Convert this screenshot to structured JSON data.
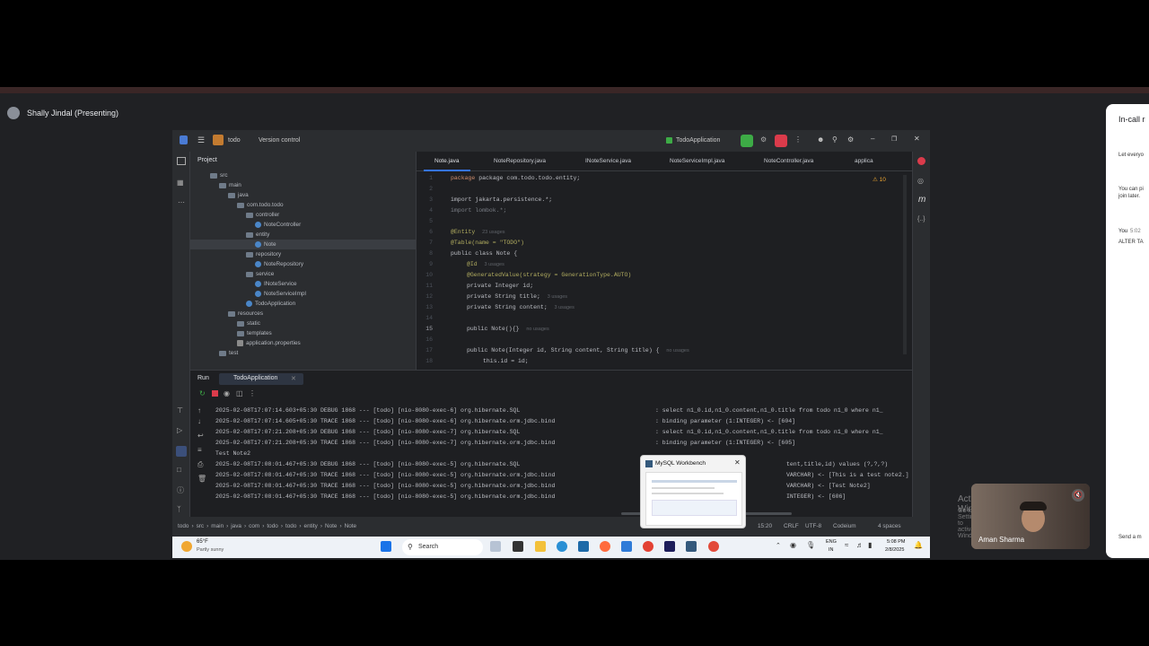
{
  "meet": {
    "presenter_label": "Shally Jindal (Presenting)",
    "side_panel": {
      "title": "In-call r",
      "line1": "Let everyo",
      "line2a": "You can pi",
      "line2b": "join later.",
      "msg_author": "You",
      "msg_time": "5:02",
      "msg_text": "ALTER TA",
      "send_placeholder": "Send a m"
    },
    "webcam_name": "Aman Sharma"
  },
  "ide": {
    "project_name": "todo",
    "vcs": "Version control",
    "run_config": "TodoApplication",
    "project_panel_title": "Project",
    "tree": [
      {
        "label": "src",
        "type": "folder",
        "indent": 0
      },
      {
        "label": "main",
        "type": "folder",
        "indent": 1
      },
      {
        "label": "java",
        "type": "folder",
        "indent": 2
      },
      {
        "label": "com.todo.todo",
        "type": "folder",
        "indent": 3
      },
      {
        "label": "controller",
        "type": "folder",
        "indent": 4
      },
      {
        "label": "NoteController",
        "type": "class",
        "indent": 5
      },
      {
        "label": "entity",
        "type": "folder",
        "indent": 4
      },
      {
        "label": "Note",
        "type": "class",
        "indent": 5,
        "selected": true
      },
      {
        "label": "repository",
        "type": "folder",
        "indent": 4
      },
      {
        "label": "NoteRepository",
        "type": "class",
        "indent": 5
      },
      {
        "label": "service",
        "type": "folder",
        "indent": 4
      },
      {
        "label": "INoteService",
        "type": "class",
        "indent": 5
      },
      {
        "label": "NoteServiceImpl",
        "type": "class",
        "indent": 5
      },
      {
        "label": "TodoApplication",
        "type": "class",
        "indent": 4
      },
      {
        "label": "resources",
        "type": "folder",
        "indent": 2
      },
      {
        "label": "static",
        "type": "folder",
        "indent": 3
      },
      {
        "label": "templates",
        "type": "folder",
        "indent": 3
      },
      {
        "label": "application.properties",
        "type": "prop",
        "indent": 3
      },
      {
        "label": "test",
        "type": "folder",
        "indent": 1
      }
    ],
    "tabs": [
      "Note.java",
      "NoteRepository.java",
      "INoteService.java",
      "NoteServiceImpl.java",
      "NoteController.java",
      "applica"
    ],
    "warnings": "⚠ 10",
    "code_lines": [
      "1",
      "2",
      "3",
      "4",
      "5",
      "6",
      "7",
      "8",
      "9",
      "10",
      "11",
      "12",
      "13",
      "14",
      "15",
      "16",
      "17",
      "18"
    ],
    "code": {
      "l1": "package com.todo.todo.entity;",
      "l3": "import jakarta.persistence.*;",
      "l4": "import lombok.*;",
      "l6": "@Entity",
      "l6h": "23 usages",
      "l7": "@Table(name = \"TODO\")",
      "l8": "public class Note {",
      "l9": "@Id",
      "l9h": "3 usages",
      "l10": "@GeneratedValue(strategy = GenerationType.AUTO)",
      "l11": "private Integer id;",
      "l12": "private String title;",
      "l12h": "3 usages",
      "l13": "private String content;",
      "l13h": "3 usages",
      "l15": "public Note(){}",
      "l15h": "no usages",
      "l17": "public Note(Integer id, String content, String title) {",
      "l17h": "no usages",
      "l18": "this.id = id;"
    },
    "run": {
      "tab_run": "Run",
      "tab_app": "TodoApplication",
      "logs": [
        {
          "left": "2025-02-08T17:07:14.603+05:30 DEBUG 1868 --- [todo] [nio-8080-exec-6] org.hibernate.SQL",
          "right": ": select n1_0.id,n1_0.content,n1_0.title from todo n1_0 where n1_"
        },
        {
          "left": "2025-02-08T17:07:14.605+05:30 TRACE 1868 --- [todo] [nio-8080-exec-6] org.hibernate.orm.jdbc.bind",
          "right": ": binding parameter (1:INTEGER) <- [604]"
        },
        {
          "left": "2025-02-08T17:07:21.208+05:30 DEBUG 1868 --- [todo] [nio-8080-exec-7] org.hibernate.SQL",
          "right": ": select n1_0.id,n1_0.content,n1_0.title from todo n1_0 where n1_"
        },
        {
          "left": "2025-02-08T17:07:21.208+05:30 TRACE 1868 --- [todo] [nio-8080-exec-7] org.hibernate.orm.jdbc.bind",
          "right": ": binding parameter (1:INTEGER) <- [605]"
        },
        {
          "left": "Test Note2",
          "right": ""
        },
        {
          "left": "2025-02-08T17:08:01.467+05:30 DEBUG 1868 --- [todo] [nio-8080-exec-5] org.hibernate.SQL",
          "right": "tent,title,id) values (?,?,?)"
        },
        {
          "left": "2025-02-08T17:08:01.467+05:30 TRACE 1868 --- [todo] [nio-8080-exec-5] org.hibernate.orm.jdbc.bind",
          "right": "VARCHAR) <- [This is a test note2.]"
        },
        {
          "left": "2025-02-08T17:08:01.467+05:30 TRACE 1868 --- [todo] [nio-8080-exec-5] org.hibernate.orm.jdbc.bind",
          "right": "VARCHAR) <- [Test Note2]"
        },
        {
          "left": "2025-02-08T17:08:01.467+05:30 TRACE 1868 --- [todo] [nio-8080-exec-5] org.hibernate.orm.jdbc.bind",
          "right": "INTEGER) <- [606]"
        }
      ]
    },
    "breadcrumb": [
      "todo",
      "src",
      "main",
      "java",
      "com",
      "todo",
      "todo",
      "entity",
      "Note",
      "Note"
    ],
    "status_right": {
      "pos": "15:20",
      "eol": "CRLF",
      "enc": "UTF-8",
      "plugin": "Codeium",
      "indent": "4 spaces"
    },
    "activate_title": "Activate Windows",
    "activate_sub": "Go to Settings to activate Windows."
  },
  "taskbar": {
    "weather_temp": "65°F",
    "weather_desc": "Partly sunny",
    "search_label": "Search",
    "popup_title": "MySQL Workbench",
    "lang": "ENG",
    "region": "IN",
    "time": "5:08 PM",
    "date": "2/8/2025"
  },
  "colors": {
    "ide_bg": "#1e1f22",
    "accent": "#3574f0",
    "run_green": "#3dab46",
    "stop_red": "#db3b4b"
  }
}
